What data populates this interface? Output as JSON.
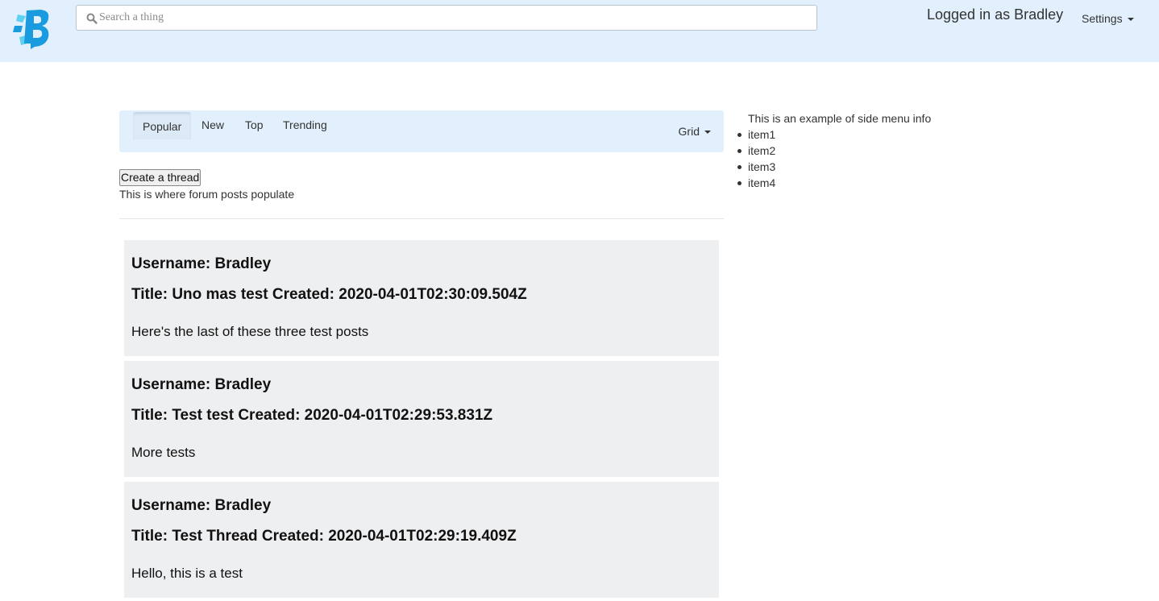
{
  "header": {
    "search_placeholder": "Search a thing",
    "logged_in_text": "Logged in as Bradley",
    "settings_label": "Settings"
  },
  "nav": {
    "tabs": [
      {
        "label": "Popular",
        "active": true
      },
      {
        "label": "New",
        "active": false
      },
      {
        "label": "Top",
        "active": false
      },
      {
        "label": "Trending",
        "active": false
      }
    ],
    "view_label": "Grid"
  },
  "main": {
    "create_button": "Create a thread",
    "forum_note": "This is where forum posts populate",
    "posts": [
      {
        "username": "Username: Bradley",
        "title": "Title: Uno mas test Created: 2020-04-01T02:30:09.504Z",
        "body": "Here's the last of these three test posts"
      },
      {
        "username": "Username: Bradley",
        "title": "Title: Test test Created: 2020-04-01T02:29:53.831Z",
        "body": "More tests"
      },
      {
        "username": "Username: Bradley",
        "title": "Title: Test Thread Created: 2020-04-01T02:29:19.409Z",
        "body": "Hello, this is a test"
      }
    ]
  },
  "side": {
    "intro": "This is an example of side menu info",
    "items": [
      "item1",
      "item2",
      "item3",
      "item4"
    ]
  },
  "colors": {
    "header_bg": "#e2f0fd",
    "post_bg": "#eeeff1",
    "logo_primary": "#1a9be0",
    "logo_light": "#5fd0f2"
  },
  "icons": {
    "logo": "brand-logo",
    "search": "search-icon",
    "dropdown": "caret-down-icon"
  }
}
